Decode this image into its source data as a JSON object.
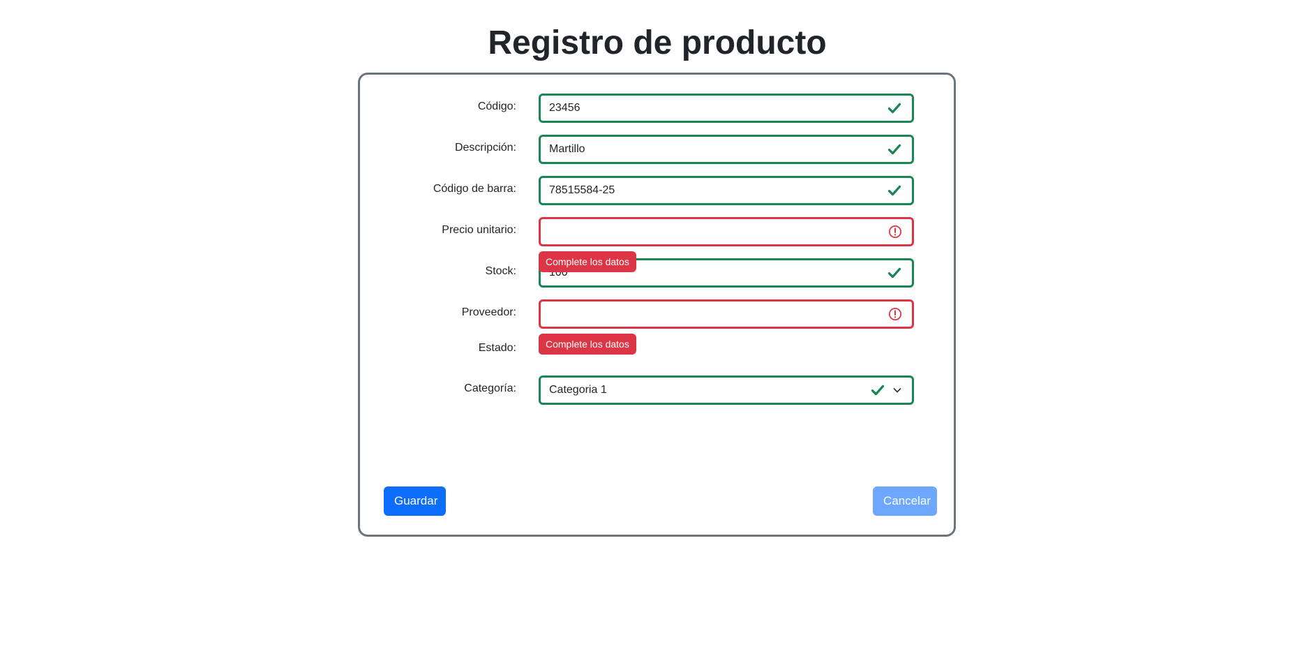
{
  "page": {
    "title": "Registro de producto"
  },
  "form": {
    "codigo": {
      "label": "Código:",
      "value": "23456",
      "state": "valid"
    },
    "descripcion": {
      "label": "Descripción:",
      "value": "Martillo",
      "state": "valid"
    },
    "codigo_barra": {
      "label": "Código de barra:",
      "value": "78515584-25",
      "state": "valid"
    },
    "precio_unitario": {
      "label": "Precio unitario:",
      "value": "",
      "state": "invalid",
      "error": "Complete los datos"
    },
    "stock": {
      "label": "Stock:",
      "value": "100",
      "state": "valid"
    },
    "proveedor": {
      "label": "Proveedor:",
      "value": "",
      "state": "invalid",
      "error": "Complete los datos"
    },
    "estado": {
      "label": "Estado:"
    },
    "categoria": {
      "label": "Categoría:",
      "selected": "Categoria 1",
      "state": "valid"
    }
  },
  "actions": {
    "save_label": "Guardar",
    "cancel_label": "Cancelar"
  },
  "colors": {
    "valid": "#198754",
    "invalid": "#dc3545",
    "primary": "#0d6efd",
    "primary_light": "#6ea8fe",
    "card_border": "#6c757d"
  },
  "icons": {
    "valid": "check-icon",
    "invalid": "exclamation-circle-icon",
    "dropdown": "chevron-down-icon"
  }
}
